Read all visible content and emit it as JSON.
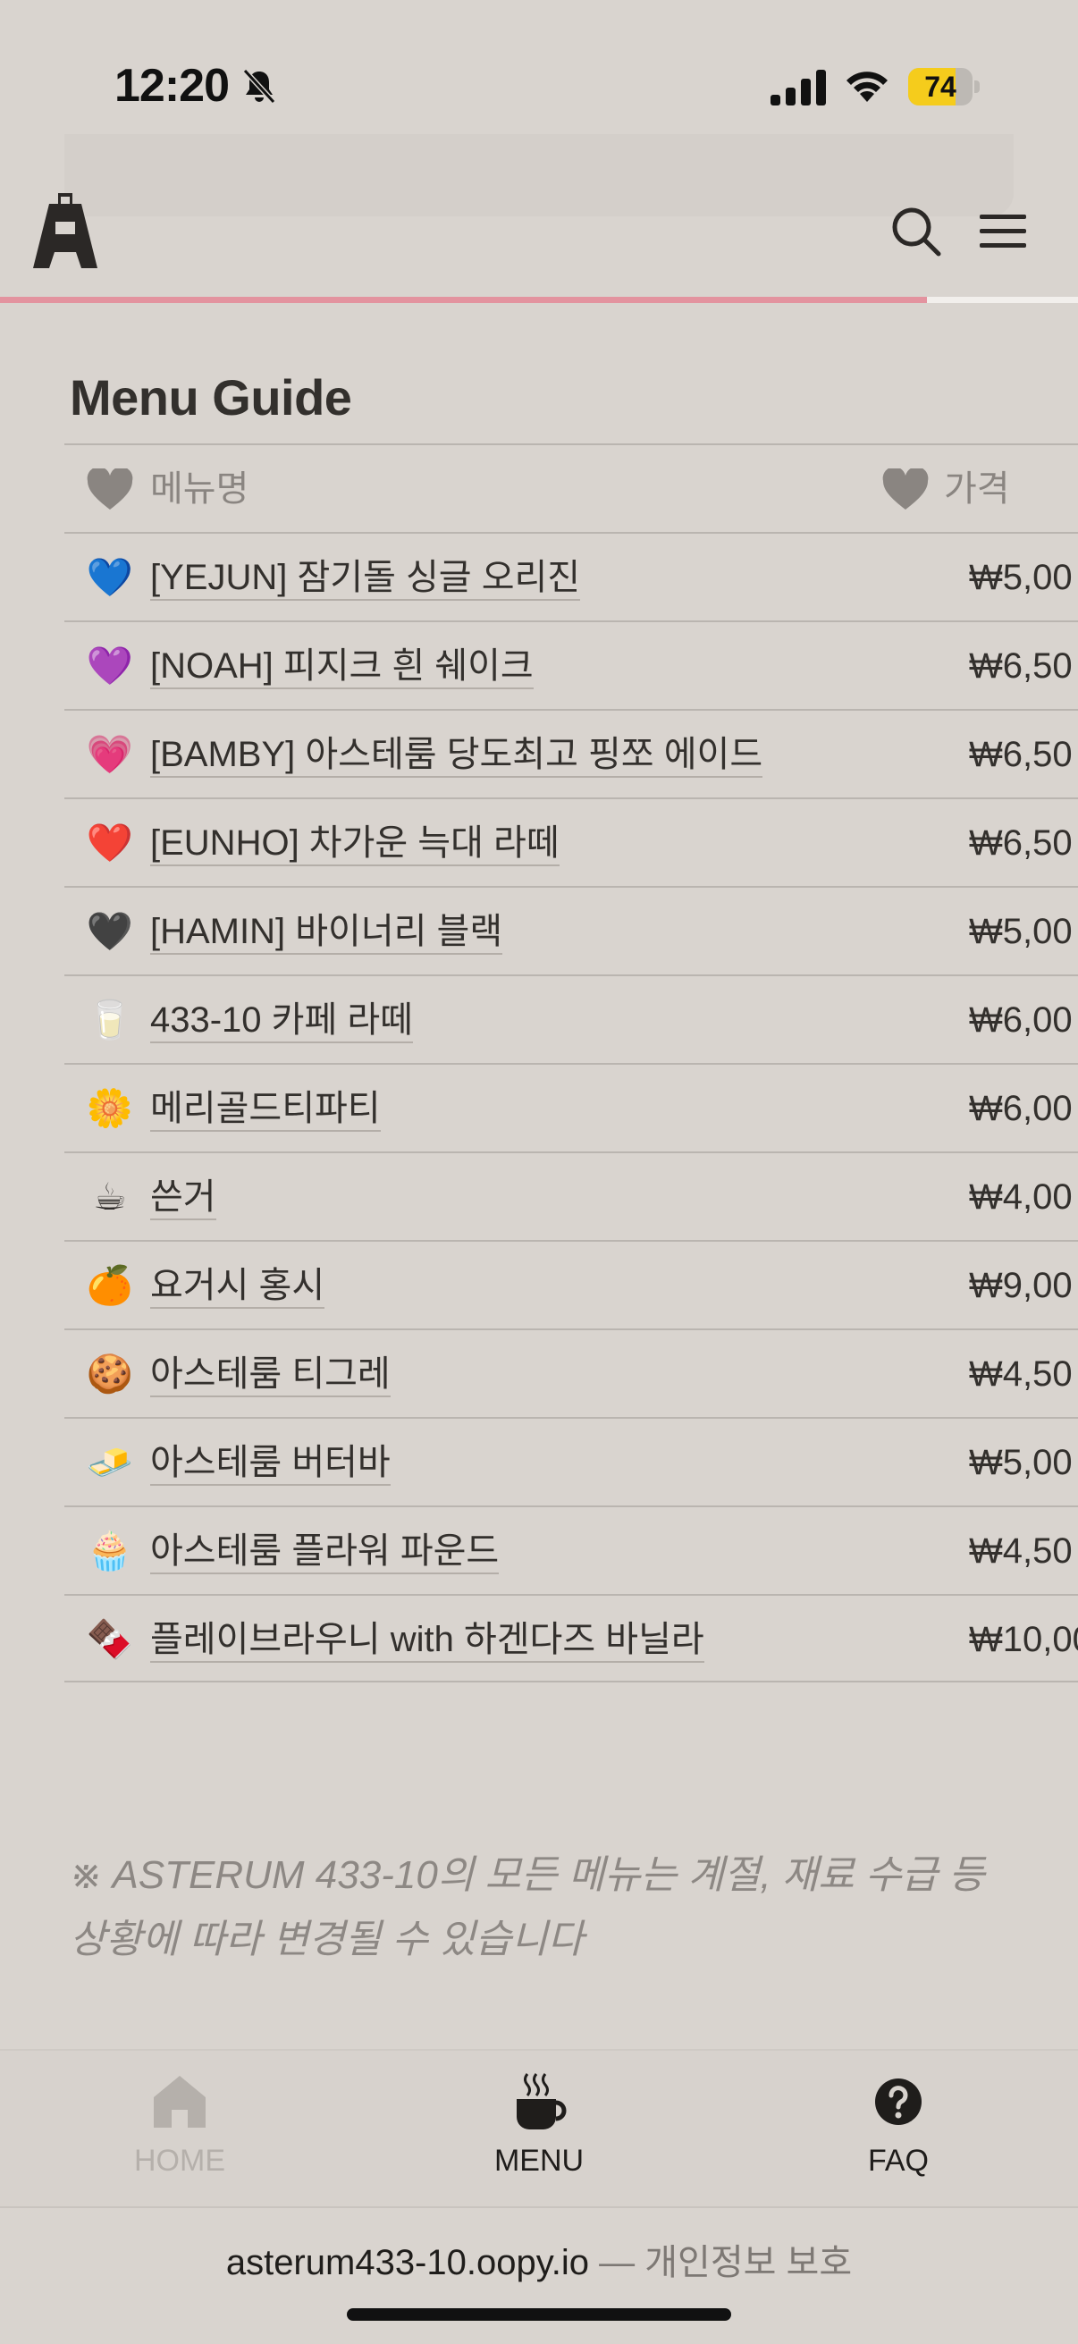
{
  "status_bar": {
    "time": "12:20",
    "battery": "74",
    "battery_level": 0.74,
    "icons": [
      "bell-off-icon",
      "cellular-signal-icon",
      "wifi-icon",
      "battery-icon"
    ]
  },
  "header": {
    "logo": "asterum-logo-icon",
    "icons": [
      "search-icon",
      "hamburger-menu-icon"
    ],
    "scroll_progress": 0.86,
    "progress_color": "#e3939f"
  },
  "page": {
    "title": "Menu Guide"
  },
  "table": {
    "columns": [
      "메뉴명",
      "가격"
    ],
    "rows": [
      {
        "icon": "💙",
        "name": "[YEJUN] 잠기돌 싱글 오리진",
        "price": "₩5,00"
      },
      {
        "icon": "💜",
        "name": "[NOAH] 피지크 흰 쉐이크",
        "price": "₩6,50"
      },
      {
        "icon": "💗",
        "name": "[BAMBY] 아스테룸 당도최고 핑쪼 에이드",
        "price": "₩6,50"
      },
      {
        "icon": "❤️",
        "name": "[EUNHO] 차가운 늑대 라떼",
        "price": "₩6,50"
      },
      {
        "icon": "🖤",
        "name": "[HAMIN] 바이너리 블랙",
        "price": "₩5,00"
      },
      {
        "icon": "🥛",
        "name": "433-10 카페 라떼",
        "price": "₩6,00"
      },
      {
        "icon": "🌼",
        "name": "메리골드티파티",
        "price": "₩6,00"
      },
      {
        "icon": "☕",
        "name": "쓴거",
        "price": "₩4,00"
      },
      {
        "icon": "🍊",
        "name": "요거시 홍시",
        "price": "₩9,00"
      },
      {
        "icon": "🍪",
        "name": "아스테룸 티그레",
        "price": "₩4,50"
      },
      {
        "icon": "🧈",
        "name": "아스테룸 버터바",
        "price": "₩5,00"
      },
      {
        "icon": "🧁",
        "name": "아스테룸 플라워 파운드",
        "price": "₩4,50"
      },
      {
        "icon": "🍫",
        "name": "플레이브라우니 with 하겐다즈 바닐라",
        "price": "₩10,00"
      }
    ]
  },
  "note": "※ ASTERUM 433-10의 모든 메뉴는 계절, 재료 수급 등 상황에 따라 변경될 수 있습니다",
  "bottom_nav": {
    "items": [
      {
        "label": "HOME",
        "icon": "home-icon",
        "active": false
      },
      {
        "label": "MENU",
        "icon": "coffee-cup-icon",
        "active": true
      },
      {
        "label": "FAQ",
        "icon": "question-circle-icon",
        "active": true
      }
    ]
  },
  "footer": {
    "domain": "asterum433-10.oopy.io",
    "separator": " — ",
    "link": "개인정보 보호"
  }
}
